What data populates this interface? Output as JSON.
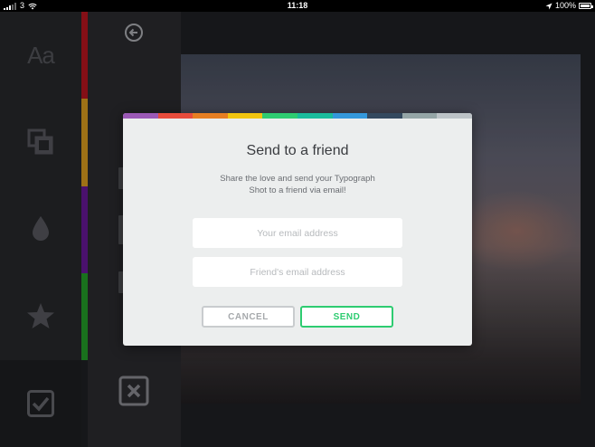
{
  "status_bar": {
    "carrier": "3",
    "time": "11:18",
    "battery": "100%"
  },
  "sidebar": {
    "font_tool_glyph": "Aa",
    "tools": [
      {
        "icon": "font-icon"
      },
      {
        "icon": "layers-icon"
      },
      {
        "icon": "drop-icon"
      },
      {
        "icon": "star-icon"
      },
      {
        "icon": "check-icon",
        "active": true
      }
    ],
    "colors": [
      "#a3131b",
      "#c18a1b",
      "#5b1585",
      "#1f8a24"
    ]
  },
  "panel2": {
    "back_icon": "back-arrow-icon",
    "close_icon": "close-icon"
  },
  "modal": {
    "stripe_colors": [
      "#9b59b6",
      "#e74c3c",
      "#e67e22",
      "#f1c40f",
      "#2ecc71",
      "#1abc9c",
      "#3498db",
      "#34495e",
      "#95a5a6",
      "#bdc3c7"
    ],
    "title": "Send to a friend",
    "description_line1": "Share the love and send your Typograph",
    "description_line2": "Shot to a friend via email!",
    "email_placeholder": "Your email address",
    "friend_email_placeholder": "Friend's email address",
    "cancel_label": "CANCEL",
    "send_label": "SEND"
  }
}
